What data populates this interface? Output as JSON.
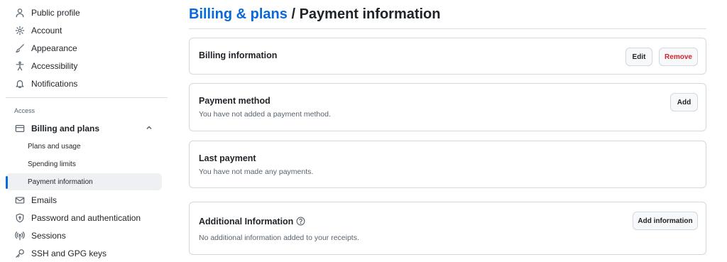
{
  "sidebar": {
    "top_items": [
      {
        "label": "Public profile",
        "icon": "person-icon"
      },
      {
        "label": "Account",
        "icon": "gear-icon"
      },
      {
        "label": "Appearance",
        "icon": "paintbrush-icon"
      },
      {
        "label": "Accessibility",
        "icon": "accessibility-icon"
      },
      {
        "label": "Notifications",
        "icon": "bell-icon"
      }
    ],
    "access_label": "Access",
    "billing": {
      "label": "Billing and plans",
      "icon": "credit-card-icon",
      "expanded": true
    },
    "billing_sub": [
      {
        "label": "Plans and usage"
      },
      {
        "label": "Spending limits"
      },
      {
        "label": "Payment information",
        "active": true
      }
    ],
    "bottom_items": [
      {
        "label": "Emails",
        "icon": "mail-icon"
      },
      {
        "label": "Password and authentication",
        "icon": "shield-lock-icon"
      },
      {
        "label": "Sessions",
        "icon": "broadcast-icon"
      },
      {
        "label": "SSH and GPG keys",
        "icon": "key-icon"
      }
    ]
  },
  "header": {
    "breadcrumb_link": "Billing & plans",
    "separator": " / ",
    "current": "Payment information"
  },
  "cards": {
    "billing_info": {
      "title": "Billing information",
      "edit_label": "Edit",
      "remove_label": "Remove"
    },
    "payment_method": {
      "title": "Payment method",
      "desc": "You have not added a payment method.",
      "add_label": "Add"
    },
    "last_payment": {
      "title": "Last payment",
      "desc": "You have not made any payments."
    },
    "additional_info": {
      "title": "Additional Information",
      "desc": "No additional information added to your receipts.",
      "add_label": "Add information"
    }
  },
  "colors": {
    "accent": "#0969da",
    "danger": "#d1242f",
    "muted": "#59636e",
    "border": "#d1d9e0"
  }
}
